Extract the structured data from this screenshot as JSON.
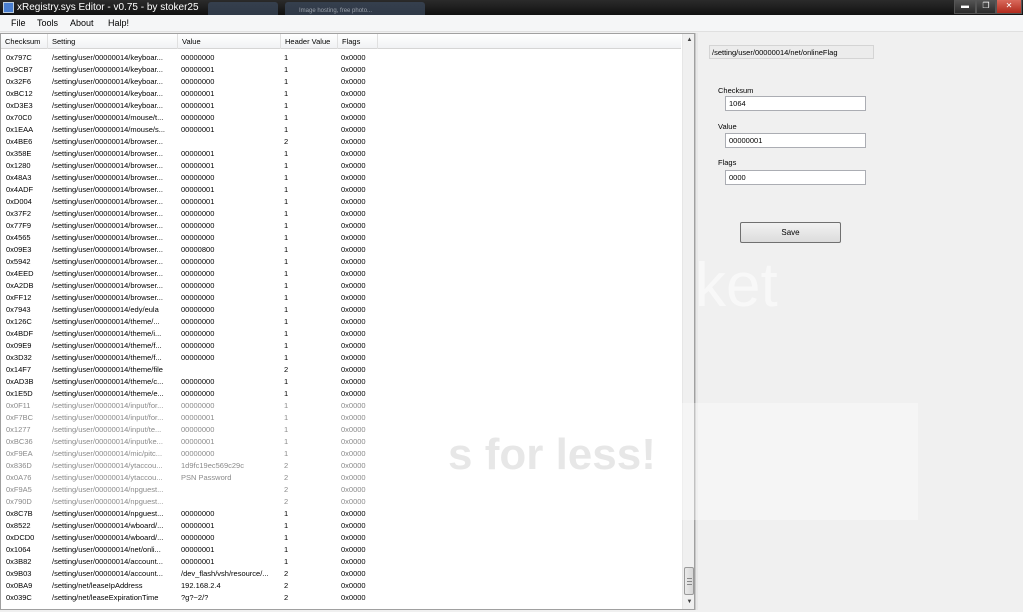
{
  "window": {
    "title": "xRegistry.sys Editor - v0.75 - by stoker25",
    "background_tabs": [
      "",
      "Image hosting, free photo...",
      ""
    ],
    "minimize": "▬",
    "maximize": "❐",
    "close": "✕"
  },
  "menu": [
    "File",
    "Tools",
    "About",
    "Halp!"
  ],
  "columns": [
    "Checksum",
    "Setting",
    "Value",
    "Header Value",
    "Flags"
  ],
  "rows": [
    [
      "0x797C",
      "/setting/user/00000014/keyboar...",
      "00000000",
      "1",
      "0x0000"
    ],
    [
      "0x9CB7",
      "/setting/user/00000014/keyboar...",
      "00000001",
      "1",
      "0x0000"
    ],
    [
      "0x32F6",
      "/setting/user/00000014/keyboar...",
      "00000000",
      "1",
      "0x0000"
    ],
    [
      "0xBC12",
      "/setting/user/00000014/keyboar...",
      "00000001",
      "1",
      "0x0000"
    ],
    [
      "0xD3E3",
      "/setting/user/00000014/keyboar...",
      "00000001",
      "1",
      "0x0000"
    ],
    [
      "0x70C0",
      "/setting/user/00000014/mouse/t...",
      "00000000",
      "1",
      "0x0000"
    ],
    [
      "0x1EAA",
      "/setting/user/00000014/mouse/s...",
      "00000001",
      "1",
      "0x0000"
    ],
    [
      "0x4BE6",
      "/setting/user/00000014/browser...",
      "",
      "2",
      "0x0000"
    ],
    [
      "0x358E",
      "/setting/user/00000014/browser...",
      "00000001",
      "1",
      "0x0000"
    ],
    [
      "0x1280",
      "/setting/user/00000014/browser...",
      "00000001",
      "1",
      "0x0000"
    ],
    [
      "0x48A3",
      "/setting/user/00000014/browser...",
      "00000000",
      "1",
      "0x0000"
    ],
    [
      "0x4ADF",
      "/setting/user/00000014/browser...",
      "00000001",
      "1",
      "0x0000"
    ],
    [
      "0xD004",
      "/setting/user/00000014/browser...",
      "00000001",
      "1",
      "0x0000"
    ],
    [
      "0x37F2",
      "/setting/user/00000014/browser...",
      "00000000",
      "1",
      "0x0000"
    ],
    [
      "0x77F9",
      "/setting/user/00000014/browser...",
      "00000000",
      "1",
      "0x0000"
    ],
    [
      "0x4565",
      "/setting/user/00000014/browser...",
      "00000000",
      "1",
      "0x0000"
    ],
    [
      "0x09E3",
      "/setting/user/00000014/browser...",
      "00000800",
      "1",
      "0x0000"
    ],
    [
      "0x5942",
      "/setting/user/00000014/browser...",
      "00000000",
      "1",
      "0x0000"
    ],
    [
      "0x4EED",
      "/setting/user/00000014/browser...",
      "00000000",
      "1",
      "0x0000"
    ],
    [
      "0xA2DB",
      "/setting/user/00000014/browser...",
      "00000000",
      "1",
      "0x0000"
    ],
    [
      "0xFF12",
      "/setting/user/00000014/browser...",
      "00000000",
      "1",
      "0x0000"
    ],
    [
      "0x7943",
      "/setting/user/00000014/edy/eula",
      "00000000",
      "1",
      "0x0000"
    ],
    [
      "0x126C",
      "/setting/user/00000014/theme/...",
      "00000000",
      "1",
      "0x0000"
    ],
    [
      "0x4BDF",
      "/setting/user/00000014/theme/i...",
      "00000000",
      "1",
      "0x0000"
    ],
    [
      "0x09E9",
      "/setting/user/00000014/theme/f...",
      "00000000",
      "1",
      "0x0000"
    ],
    [
      "0x3D32",
      "/setting/user/00000014/theme/f...",
      "00000000",
      "1",
      "0x0000"
    ],
    [
      "0x14F7",
      "/setting/user/00000014/theme/file",
      "",
      "2",
      "0x0000"
    ],
    [
      "0xAD3B",
      "/setting/user/00000014/theme/c...",
      "00000000",
      "1",
      "0x0000"
    ],
    [
      "0x1E5D",
      "/setting/user/00000014/theme/e...",
      "00000000",
      "1",
      "0x0000"
    ],
    [
      "0x0F11",
      "/setting/user/00000014/input/for...",
      "00000000",
      "1",
      "0x0000"
    ],
    [
      "0xF7BC",
      "/setting/user/00000014/input/for...",
      "00000001",
      "1",
      "0x0000"
    ],
    [
      "0x1277",
      "/setting/user/00000014/input/te...",
      "00000000",
      "1",
      "0x0000"
    ],
    [
      "0xBC36",
      "/setting/user/00000014/input/ke...",
      "00000001",
      "1",
      "0x0000"
    ],
    [
      "0xF9EA",
      "/setting/user/00000014/mic/pitc...",
      "00000000",
      "1",
      "0x0000"
    ],
    [
      "0x836D",
      "/setting/user/00000014/ytaccou...",
      "1d9fc19ec569c29c",
      "2",
      "0x0000"
    ],
    [
      "0x0A76",
      "/setting/user/00000014/ytaccou...",
      "PSN Password",
      "2",
      "0x0000"
    ],
    [
      "0xF9A5",
      "/setting/user/00000014/npguest...",
      "",
      "2",
      "0x0000"
    ],
    [
      "0x790D",
      "/setting/user/00000014/npguest...",
      "",
      "2",
      "0x0000"
    ],
    [
      "0x8C7B",
      "/setting/user/00000014/npguest...",
      "00000000",
      "1",
      "0x0000"
    ],
    [
      "0x8522",
      "/setting/user/00000014/wboard/...",
      "00000001",
      "1",
      "0x0000"
    ],
    [
      "0xDCD0",
      "/setting/user/00000014/wboard/...",
      "00000000",
      "1",
      "0x0000"
    ],
    [
      "0x1064",
      "/setting/user/00000014/net/onli...",
      "00000001",
      "1",
      "0x0000"
    ],
    [
      "0x3B82",
      "/setting/user/00000014/account...",
      "00000001",
      "1",
      "0x0000"
    ],
    [
      "0x9B03",
      "/setting/user/00000014/account...",
      "/dev_flash/vsh/resource/...",
      "2",
      "0x0000"
    ],
    [
      "0x0BA9",
      "/setting/net/leaseIpAddress",
      "192.168.2.4",
      "2",
      "0x0000"
    ],
    [
      "0x039C",
      "/setting/net/leaseExpirationTime",
      "?g?~2/?",
      "2",
      "0x0000"
    ]
  ],
  "dim_rows": [
    29,
    30,
    31,
    32,
    33,
    34,
    35,
    36,
    37
  ],
  "scroll": {
    "up": "▲",
    "down": "▼"
  },
  "detail": {
    "path": "/setting/user/00000014/net/onlineFlag",
    "checksum_label": "Checksum",
    "checksum_value": "1064",
    "value_label": "Value",
    "value_value": "00000001",
    "flags_label": "Flags",
    "flags_value": "0000",
    "save_label": "Save"
  },
  "watermark": {
    "line1": "ket",
    "line2": "s for less!"
  }
}
